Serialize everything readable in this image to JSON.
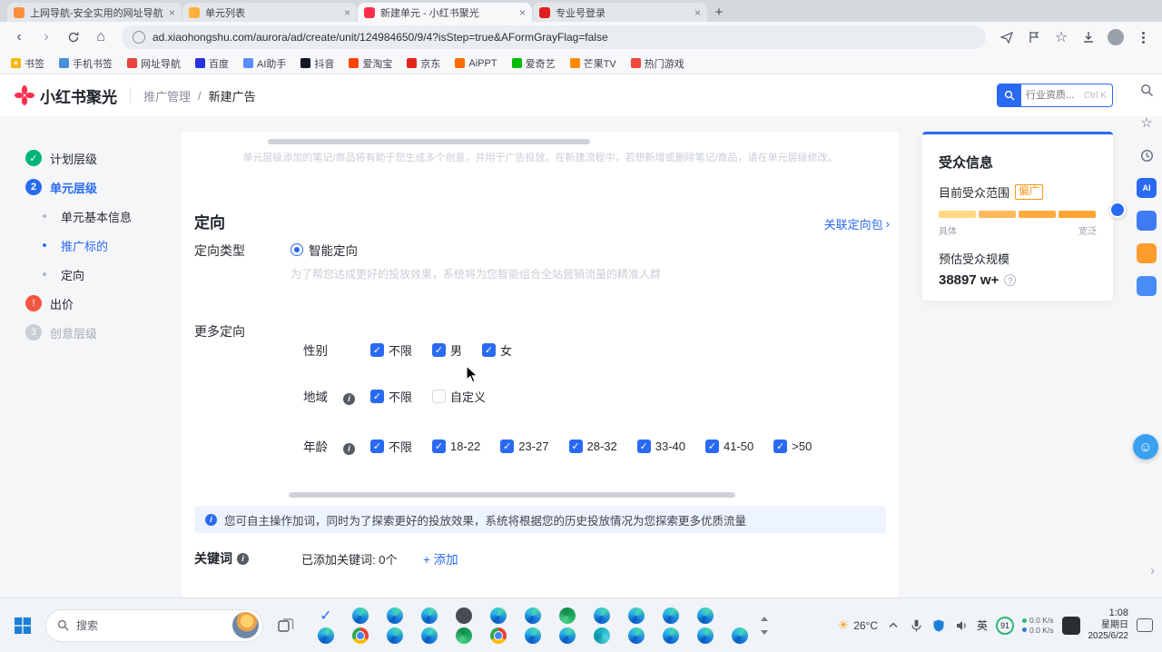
{
  "colors": {
    "accent_blue": "#2a6af2",
    "brand_red": "#ff2e4d",
    "warning_orange": "#ff9213",
    "success_green": "#00b578",
    "error_red": "#f25643"
  },
  "icons": {
    "close": "×",
    "plus": "+",
    "back": "‹",
    "forward": "›",
    "home": "⌂",
    "star": "☆",
    "chevron_right": "›",
    "smiley": "☺",
    "sun": "☀"
  },
  "browser": {
    "tabs": [
      {
        "title": "上网导航-安全实用的网址导航",
        "fav": "#ff8f3c",
        "state": ""
      },
      {
        "title": "单元列表",
        "fav": "#ffb03a",
        "state": ""
      },
      {
        "title": "新建单元 - 小红书聚光",
        "fav": "#ff2e4d",
        "state": "active"
      },
      {
        "title": "专业号登录",
        "fav": "#e02020",
        "state": ""
      }
    ],
    "url": "ad.xiaohongshu.com/aurora/ad/create/unit/124984650/9/4?isStep=true&AFormGrayFlag=false",
    "bookmarks": [
      {
        "label": "书签",
        "color": "#f7b500",
        "glyph": "★"
      },
      {
        "label": "手机书签",
        "color": "#4a90d9"
      },
      {
        "label": "网址导航",
        "color": "#e8433e"
      },
      {
        "label": "百度",
        "color": "#2932e1"
      },
      {
        "label": "AI助手",
        "color": "#5b8cff"
      },
      {
        "label": "抖音",
        "color": "#161823"
      },
      {
        "label": "爱淘宝",
        "color": "#ff4400"
      },
      {
        "label": "京东",
        "color": "#e1251b"
      },
      {
        "label": "AiPPT",
        "color": "#ff6a00"
      },
      {
        "label": "爱奇艺",
        "color": "#00be06"
      },
      {
        "label": "芒果TV",
        "color": "#ff8a00"
      },
      {
        "label": "热门游戏",
        "color": "#f0483e"
      }
    ]
  },
  "header": {
    "logo_text": "小红书聚光",
    "breadcrumb_section": "推广管理",
    "breadcrumb_sep": "/",
    "breadcrumb_current": "新建广告",
    "search_placeholder": "行业资质...",
    "search_shortcut": "Ctrl K"
  },
  "right_rail": {
    "ai_label": "AI"
  },
  "sidebar": {
    "items": [
      {
        "icon": "✓",
        "label": "计划层级",
        "state": "done"
      },
      {
        "icon": "2",
        "label": "单元层级",
        "state": "current"
      },
      {
        "icon": "•",
        "label": "单元基本信息",
        "state": "sub"
      },
      {
        "icon": "•",
        "label": "推广标的",
        "state": "sub-active"
      },
      {
        "icon": "•",
        "label": "定向",
        "state": "sub"
      },
      {
        "icon": "!",
        "label": "出价",
        "state": "error"
      },
      {
        "icon": "3",
        "label": "创意层级",
        "state": "pending"
      }
    ]
  },
  "form": {
    "scroll_hint": "单元层级添加的笔记/商品将有助于您生成多个创意，并用于广告投放。在新建流程中，若想新增或删除笔记/商品，请在单元层级修改。",
    "section_title": "定向",
    "targeting_package_link": "关联定向包",
    "targeting_type_label": "定向类型",
    "smart_targeting_label": "智能定向",
    "smart_targeting_desc": "为了帮您达成更好的投放效果，系统将为您智能组合全站营销流量的精准人群",
    "more_targeting_label": "更多定向",
    "rows": [
      {
        "label": "性别",
        "options": [
          {
            "label": "不限",
            "state": "on"
          },
          {
            "label": "男",
            "state": "on"
          },
          {
            "label": "女",
            "state": "on"
          }
        ]
      },
      {
        "label": "地域",
        "options": [
          {
            "label": "不限",
            "state": "on"
          },
          {
            "label": "自定义",
            "state": "off"
          }
        ]
      },
      {
        "label": "年龄",
        "options": [
          {
            "label": "不限",
            "state": "on"
          },
          {
            "label": "18-22",
            "state": "on"
          },
          {
            "label": "23-27",
            "state": "on"
          },
          {
            "label": "28-32",
            "state": "on"
          },
          {
            "label": "33-40",
            "state": "on"
          },
          {
            "label": "41-50",
            "state": "on"
          },
          {
            "label": ">50",
            "state": "on"
          }
        ]
      }
    ],
    "tip_text": "您可自主操作加词，同时为了探索更好的投放效果，系统将根据您的历史投放情况为您探索更多优质流量",
    "keywords_label": "关键词",
    "keywords_added_text": "已添加关键词: 0个",
    "add_keyword_label": "+ 添加"
  },
  "audience": {
    "title": "受众信息",
    "range_label": "目前受众范围",
    "range_value": "偏广",
    "segments": [
      "#ffd783",
      "#ffb95c",
      "#ffab40",
      "#ffa333"
    ],
    "scale_min": "具体",
    "scale_max": "宽泛",
    "estimate_label": "预估受众规模",
    "estimate_value": "38897 w+"
  },
  "taskbar": {
    "search_placeholder": "搜索",
    "pinned_rows": [
      [
        "check",
        "edge",
        "edge",
        "edge",
        "dark",
        "edge",
        "edge",
        "green",
        "edge",
        "edge",
        "edge",
        "edge"
      ],
      [
        "edge",
        "chrome",
        "edge",
        "edge",
        "green",
        "chrome",
        "edge",
        "edge",
        "teal",
        "edge",
        "edge",
        "edge",
        "edge"
      ]
    ],
    "temperature": "26°C",
    "lang_indicator": "英",
    "battery_badge": "91",
    "net_up": "0.0 K/s",
    "net_down": "0.0 K/s",
    "time": "1:08",
    "weekday": "星期日",
    "date": "2025/6/22"
  }
}
